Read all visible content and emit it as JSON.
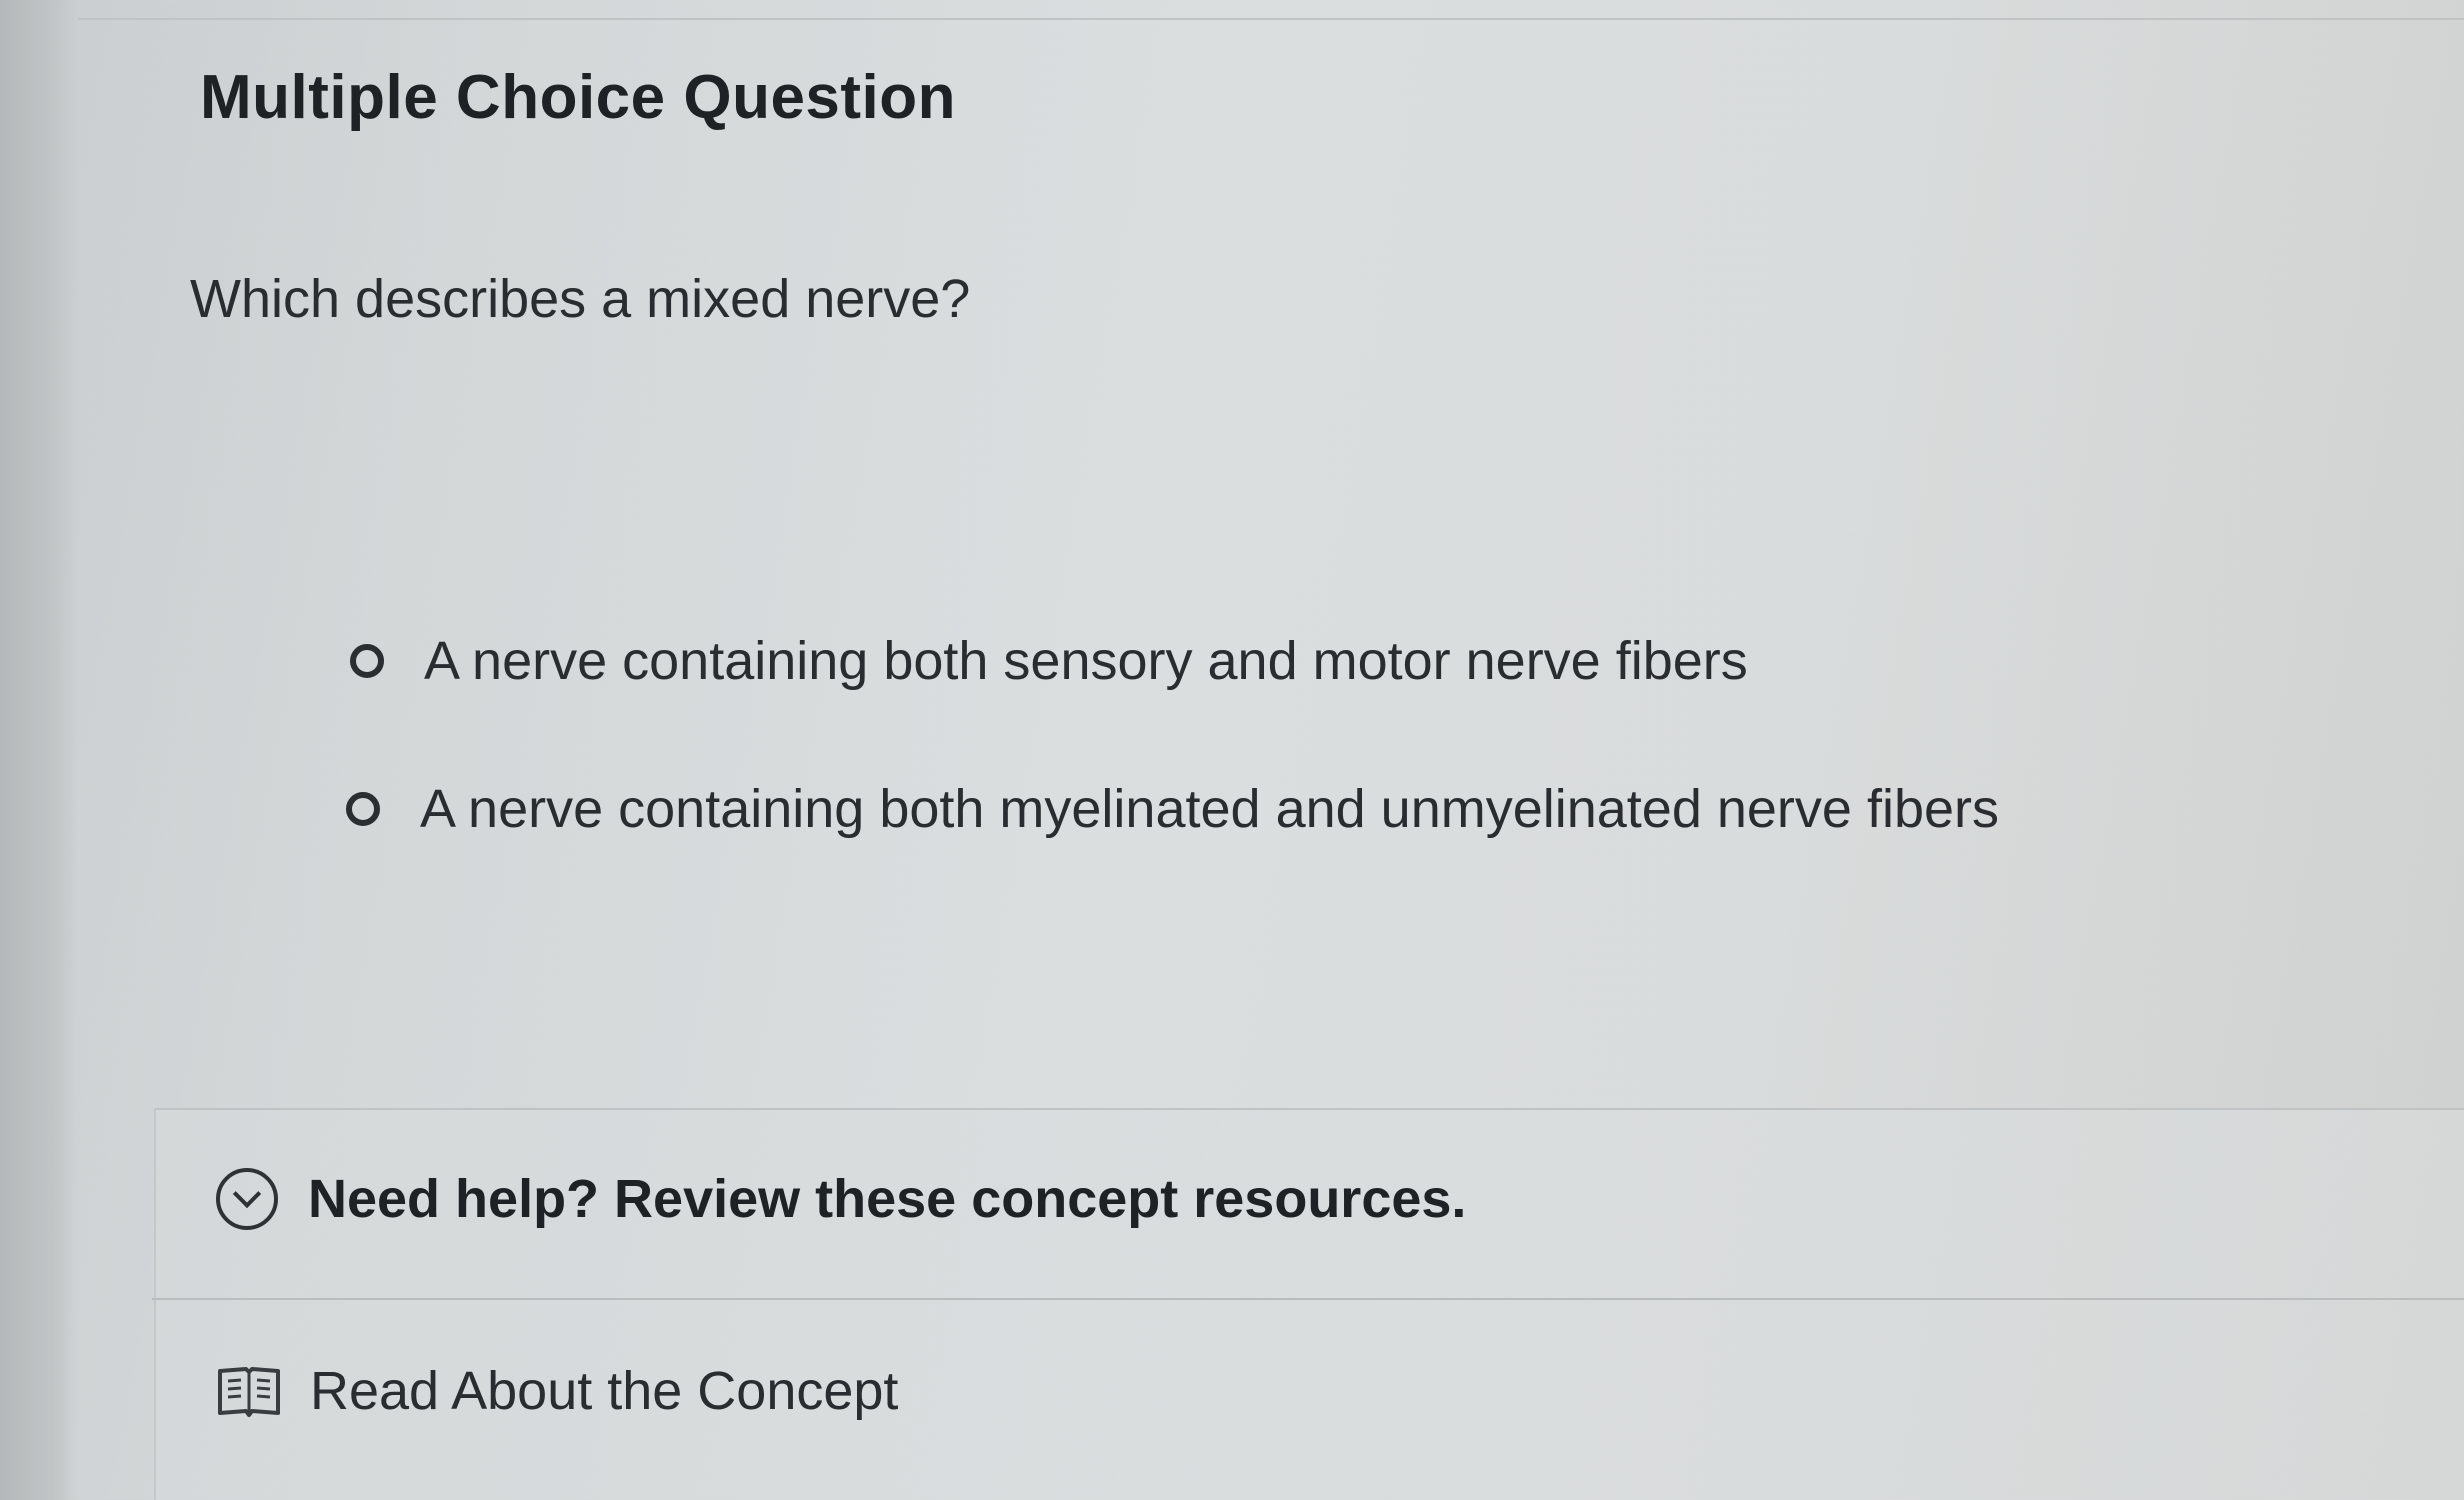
{
  "question": {
    "type_label": "Multiple Choice Question",
    "prompt": "Which describes a mixed nerve?",
    "options": [
      {
        "label": "A nerve containing both sensory and motor nerve fibers",
        "selected": false
      },
      {
        "label": "A nerve containing both myelinated and unmyelinated nerve fibers",
        "selected": false
      }
    ]
  },
  "help": {
    "header": "Need help? Review these concept resources.",
    "header_icon": "chevron-down-circle-icon",
    "resources": [
      {
        "label": "Read About the Concept",
        "icon": "book-icon"
      }
    ]
  },
  "colors": {
    "text": "#2a2d30",
    "background": "#d8dcdd",
    "divider": "#bfc3c4"
  }
}
